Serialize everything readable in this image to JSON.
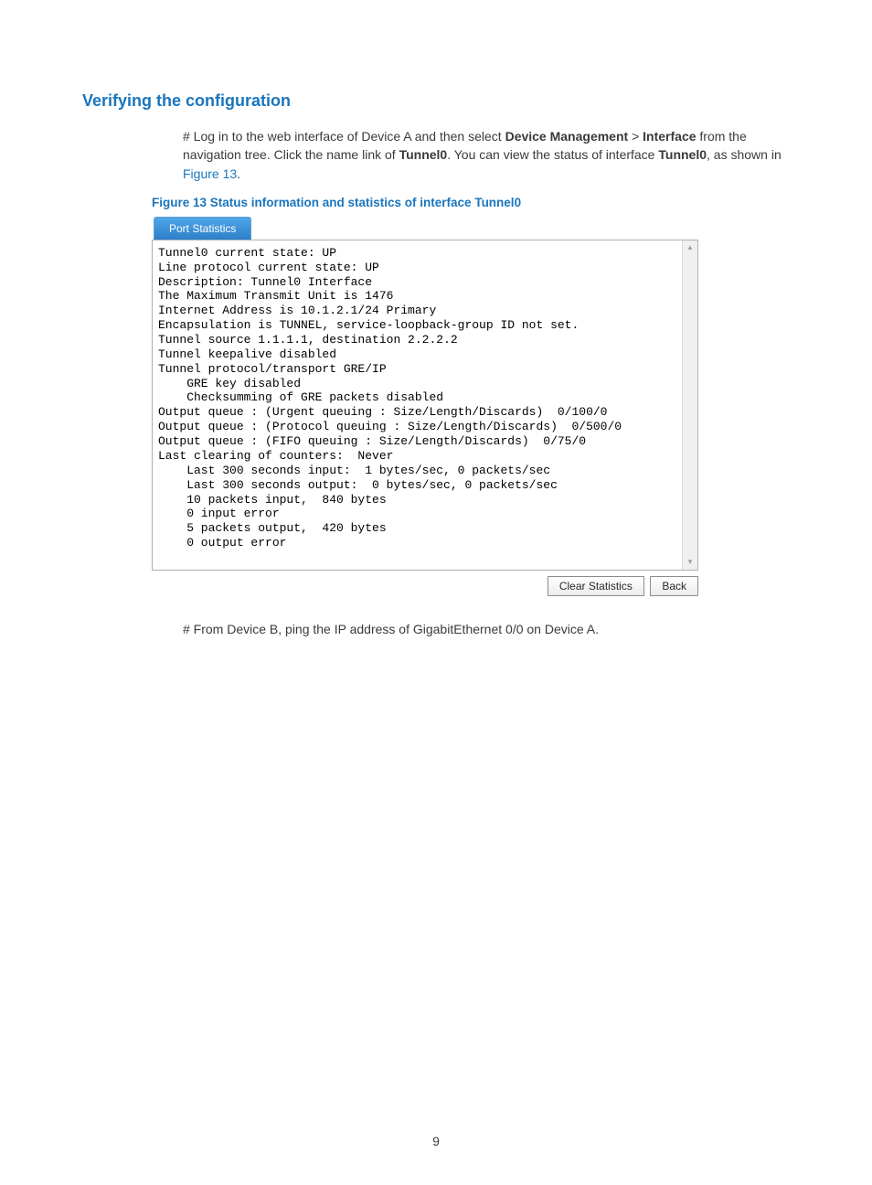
{
  "heading": "Verifying the configuration",
  "para1": {
    "prefix": "# Log in to the web interface of Device A and then select ",
    "bold1": "Device Management",
    "sep": " > ",
    "bold2": "Interface",
    "mid": " from the navigation tree. Click the name link of ",
    "bold3": "Tunnel0",
    "mid2": ". You can view the status of interface ",
    "bold4": "Tunnel0",
    "post": ", as shown in ",
    "link": "Figure 13",
    "end": "."
  },
  "figure_caption": "Figure 13 Status information and statistics of interface Tunnel0",
  "tab_label": "Port Statistics",
  "stats_text": "Tunnel0 current state: UP\nLine protocol current state: UP\nDescription: Tunnel0 Interface\nThe Maximum Transmit Unit is 1476\nInternet Address is 10.1.2.1/24 Primary\nEncapsulation is TUNNEL, service-loopback-group ID not set.\nTunnel source 1.1.1.1, destination 2.2.2.2\nTunnel keepalive disabled\nTunnel protocol/transport GRE/IP\n    GRE key disabled\n    Checksumming of GRE packets disabled\nOutput queue : (Urgent queuing : Size/Length/Discards)  0/100/0\nOutput queue : (Protocol queuing : Size/Length/Discards)  0/500/0\nOutput queue : (FIFO queuing : Size/Length/Discards)  0/75/0\nLast clearing of counters:  Never\n    Last 300 seconds input:  1 bytes/sec, 0 packets/sec\n    Last 300 seconds output:  0 bytes/sec, 0 packets/sec\n    10 packets input,  840 bytes\n    0 input error\n    5 packets output,  420 bytes\n    0 output error",
  "buttons": {
    "clear": "Clear Statistics",
    "back": "Back"
  },
  "para2": "# From Device B, ping the IP address of GigabitEthernet 0/0 on Device A.",
  "page_number": "9"
}
